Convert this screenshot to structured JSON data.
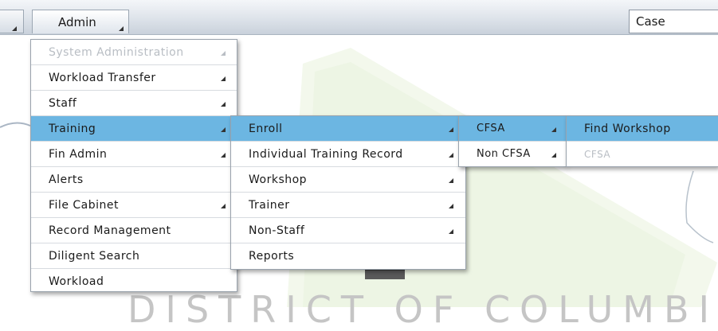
{
  "menubar": {
    "admin_label": "Admin",
    "case_label": "Case"
  },
  "admin_menu": [
    {
      "label": "System Administration",
      "disabled": true,
      "submenu": true
    },
    {
      "label": "Workload Transfer",
      "disabled": false,
      "submenu": true
    },
    {
      "label": "Staff",
      "disabled": false,
      "submenu": true
    },
    {
      "label": "Training",
      "disabled": false,
      "submenu": true,
      "active": true
    },
    {
      "label": "Fin Admin",
      "disabled": false,
      "submenu": true
    },
    {
      "label": "Alerts",
      "disabled": false,
      "submenu": false
    },
    {
      "label": "File Cabinet",
      "disabled": false,
      "submenu": true
    },
    {
      "label": "Record Management",
      "disabled": false,
      "submenu": false
    },
    {
      "label": "Diligent Search",
      "disabled": false,
      "submenu": false
    },
    {
      "label": "Workload",
      "disabled": false,
      "submenu": false
    }
  ],
  "training_menu": [
    {
      "label": "Enroll",
      "submenu": true,
      "active": true
    },
    {
      "label": "Individual Training Record",
      "submenu": true
    },
    {
      "label": "Workshop",
      "submenu": true
    },
    {
      "label": "Trainer",
      "submenu": true
    },
    {
      "label": "Non-Staff",
      "submenu": true
    },
    {
      "label": "Reports",
      "submenu": false
    }
  ],
  "enroll_menu": [
    {
      "label": "CFSA",
      "submenu": true,
      "active": true
    },
    {
      "label": "Non CFSA",
      "submenu": true
    }
  ],
  "cfsa_menu": [
    {
      "label": "Find Workshop",
      "active": true
    },
    {
      "label": "CFSA",
      "disabled": true
    }
  ],
  "background": {
    "footer_text": "DISTRICT OF COLUMBIA"
  },
  "colors": {
    "active_highlight": "#6cb6e2",
    "disabled_text": "#b9bec4",
    "menubar_top": "#f4f6f9",
    "menubar_bottom": "#c9d1db"
  }
}
